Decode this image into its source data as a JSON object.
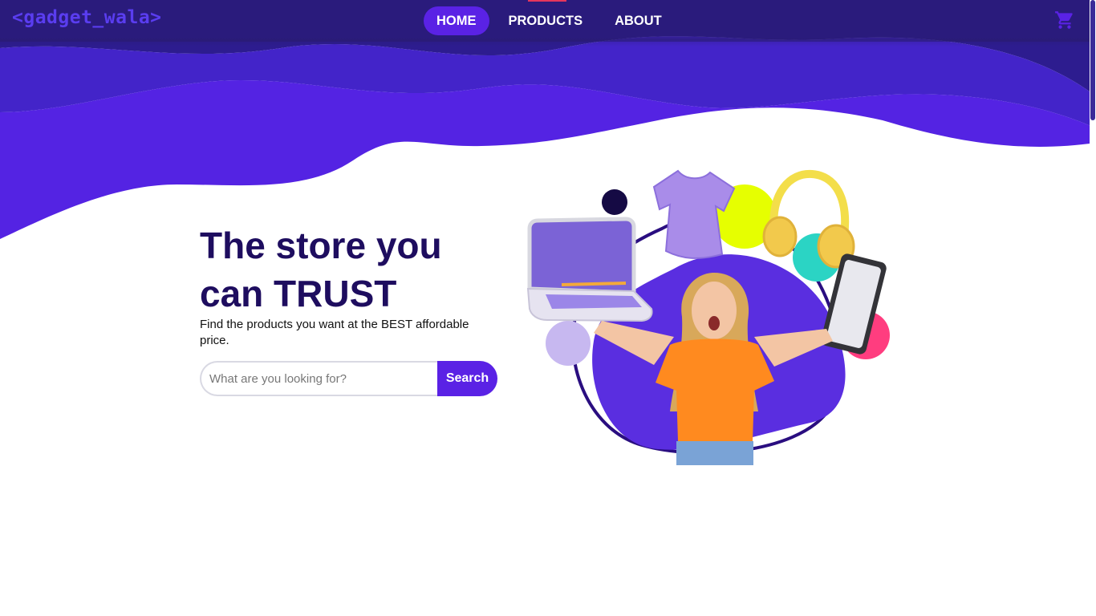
{
  "brand": {
    "logo_text": "<gadget_wala>"
  },
  "nav": {
    "items": [
      {
        "label": "HOME",
        "active": true
      },
      {
        "label": "PRODUCTS",
        "active": false
      },
      {
        "label": "ABOUT",
        "active": false
      }
    ]
  },
  "cart": {
    "icon": "shopping-cart-icon"
  },
  "hero": {
    "title_line1": "The store you",
    "title_line2": "can TRUST",
    "subtitle": "Find the products you want at the BEST affordable price.",
    "search": {
      "placeholder": "What are you looking for?",
      "value": "",
      "button_label": "Search"
    }
  },
  "colors": {
    "primary": "#5a22e5",
    "navbar": "#281c6e",
    "heading": "#1e0d5f",
    "accent_yellow": "#e6ff00",
    "accent_teal": "#2bd4c4",
    "accent_pink": "#ff3d7f"
  }
}
